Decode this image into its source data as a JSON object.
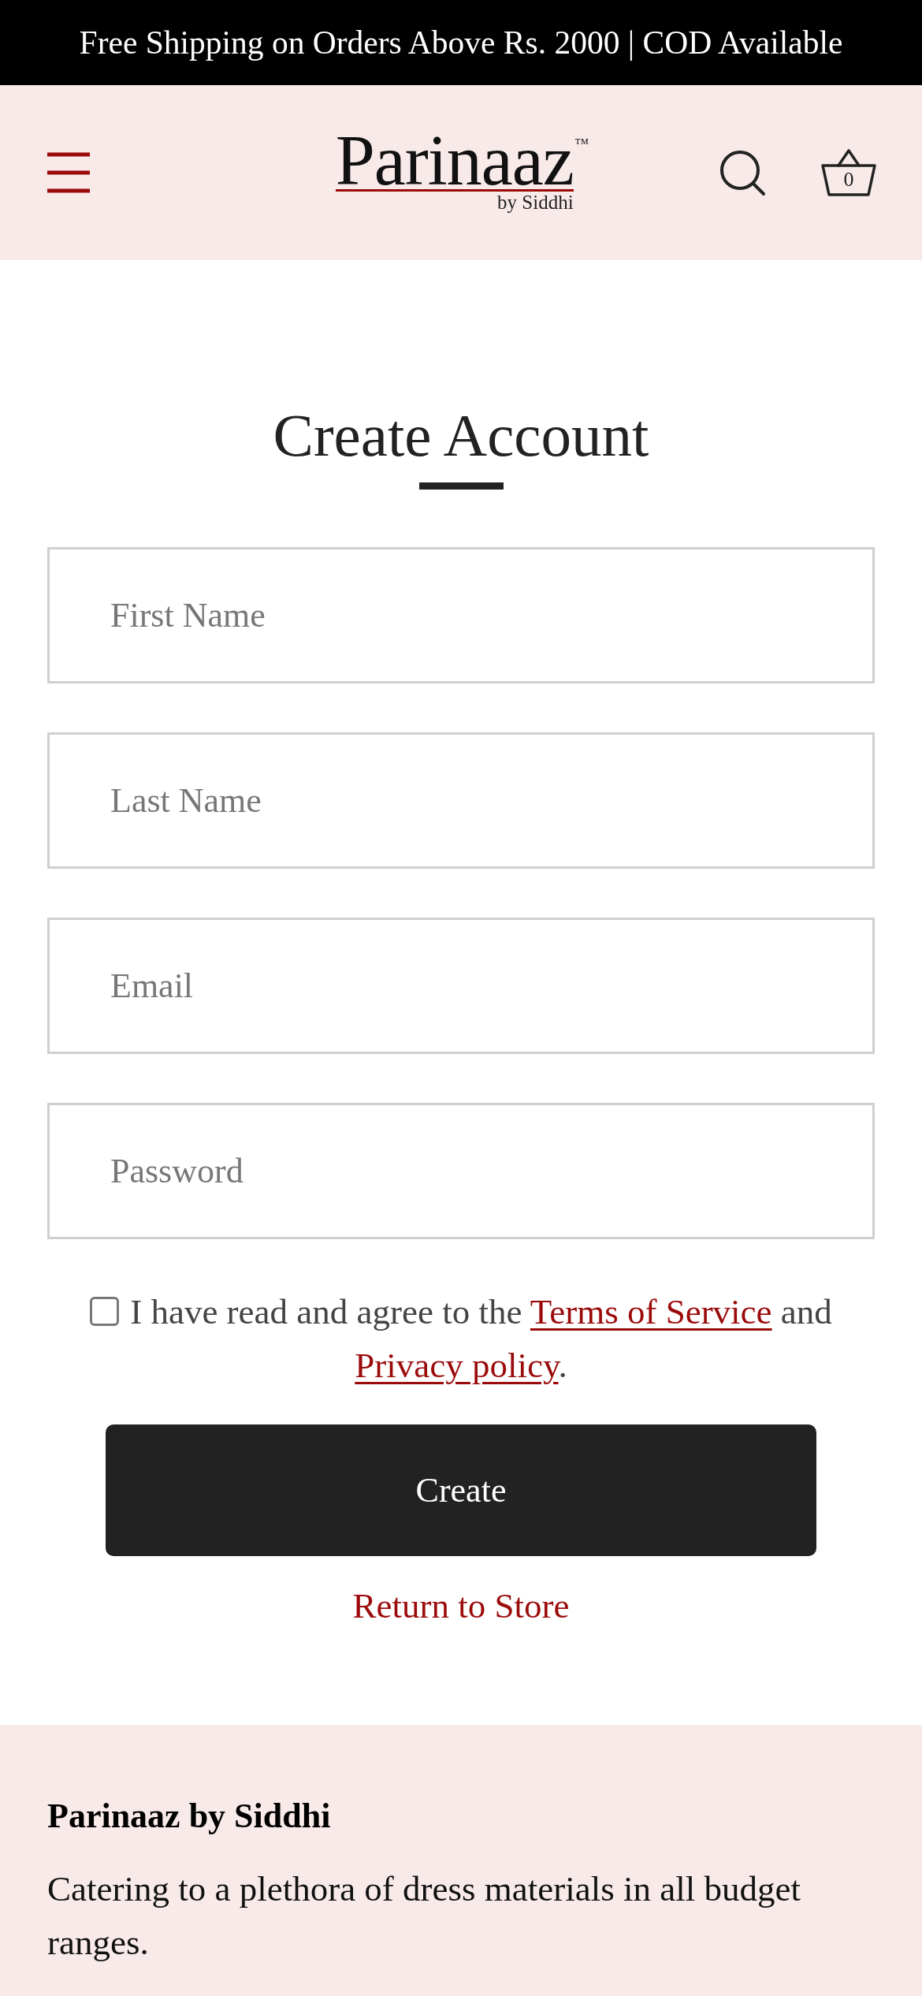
{
  "announcement_bar": {
    "text": "Free Shipping on Orders Above Rs. 2000 | COD Available"
  },
  "header": {
    "logo": {
      "name": "Parinaaz",
      "trademark": "™",
      "tagline": "by Siddhi"
    },
    "cart_count": "0"
  },
  "page_title": "Create Account",
  "form": {
    "fields": [
      {
        "placeholder": "First Name"
      },
      {
        "placeholder": "Last Name"
      },
      {
        "placeholder": "Email"
      },
      {
        "placeholder": "Password"
      }
    ],
    "agreement": {
      "checked": false,
      "text_before": "I have read and agree to the ",
      "terms_link": "Terms of Service",
      "text_between": " and ",
      "privacy_link": "Privacy policy",
      "text_after": "."
    },
    "submit_button": "Create",
    "return_link": "Return to Store"
  },
  "footer": {
    "heading": "Parinaaz by Siddhi",
    "description": "Catering to a plethora of dress materials in all budget ranges."
  }
}
